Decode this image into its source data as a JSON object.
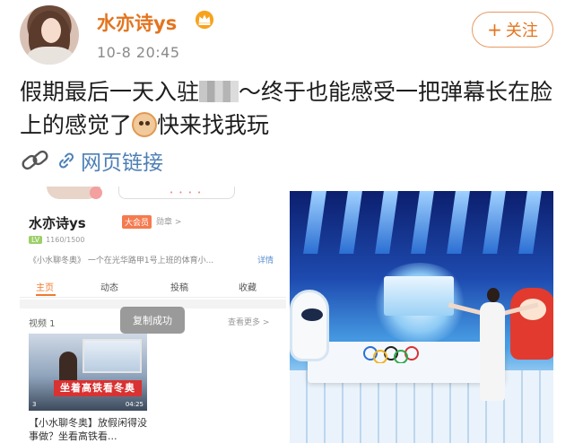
{
  "post": {
    "author": "水亦诗ys",
    "timestamp": "10-8 20:45",
    "follow_label": "关注",
    "follow_plus": "+",
    "text_part1": "假期最后一天入驻",
    "text_part2": "～终于也能感受一把弹幕长在脸上的感觉了",
    "text_part3": "快来找我玩",
    "link_label": "网页链接",
    "brand_color": "#e3741f",
    "link_color": "#4d7fb5"
  },
  "screenshot_left": {
    "name": "水亦诗ys",
    "badge": "大会员",
    "medal": "勋章 >",
    "level_badge": "LV",
    "level_progress": "1160/1500",
    "intro": "《小水聊冬奥》 一个在光华路甲1号上班的体育小...",
    "detail_link": "详情",
    "tabs": [
      "主页",
      "动态",
      "投稿",
      "收藏"
    ],
    "video_label": "视频  1",
    "more_label": "查看更多 >",
    "toast": "复制成功",
    "thumb_banner": "坐着高铁看冬奥",
    "thumb_duration": "04:25",
    "thumb_views": "3",
    "caption": "【小水聊冬奥】放假闲得没事做？坐看高铁看..."
  },
  "icons": {
    "crown": "crown-icon",
    "chain": "chain-link-icon",
    "link": "link-icon",
    "emoji": "cat-face-emoji-icon"
  }
}
